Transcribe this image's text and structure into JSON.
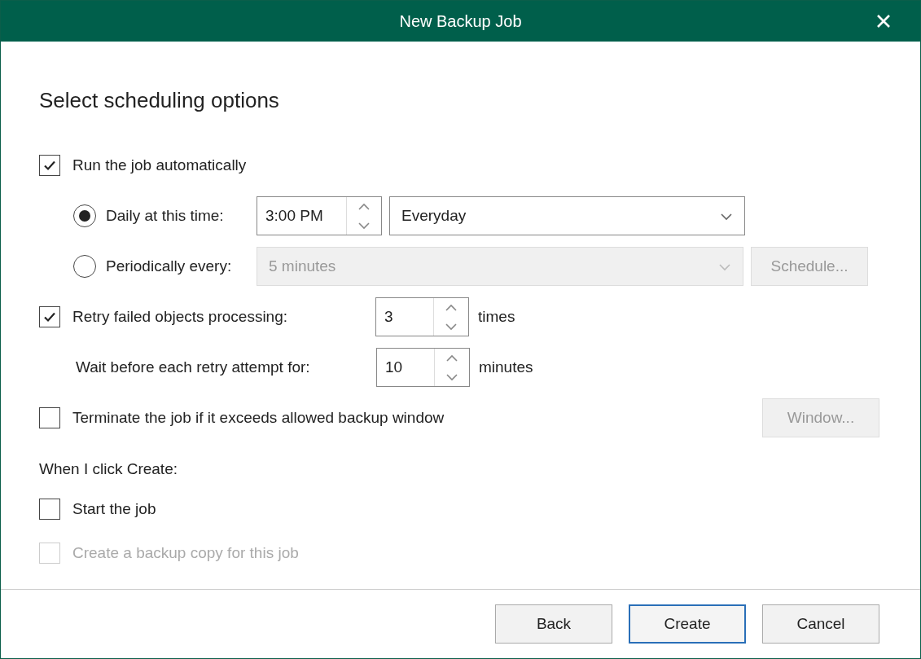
{
  "window": {
    "title": "New Backup Job"
  },
  "heading": "Select scheduling options",
  "run_automatically": {
    "label": "Run the job automatically",
    "checked": true
  },
  "schedule_options": [
    {
      "kind": "daily",
      "label": "Daily at this time:",
      "selected": true,
      "time": "3:00 PM",
      "days": "Everyday"
    },
    {
      "kind": "periodic",
      "label": "Periodically every:",
      "selected": false,
      "interval": "5 minutes",
      "button": "Schedule..."
    }
  ],
  "retry": {
    "label": "Retry failed objects processing:",
    "checked": true,
    "value": "3",
    "unit": "times"
  },
  "wait": {
    "label": "Wait before each retry attempt for:",
    "value": "10",
    "unit": "minutes"
  },
  "terminate": {
    "label": "Terminate the job if it exceeds allowed backup window",
    "checked": false,
    "button": "Window...",
    "button_disabled": true
  },
  "on_create": {
    "label": "When I click Create:",
    "options": [
      {
        "label": "Start the job",
        "checked": false,
        "disabled": false
      },
      {
        "label": "Create a backup copy for this job",
        "checked": false,
        "disabled": true
      }
    ]
  },
  "buttons": [
    {
      "label": "Back",
      "focused": false
    },
    {
      "label": "Create",
      "focused": true
    },
    {
      "label": "Cancel",
      "focused": false
    }
  ]
}
